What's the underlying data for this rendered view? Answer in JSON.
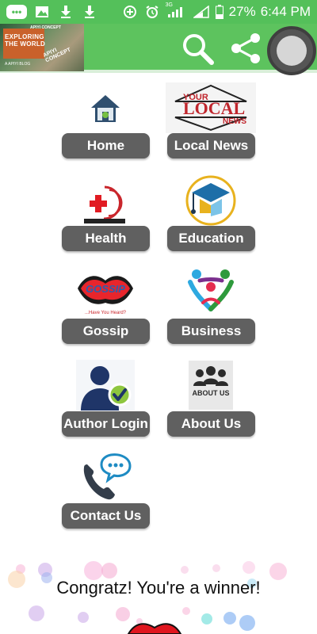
{
  "status_bar": {
    "battery_percent": "27%",
    "time": "6:44 PM",
    "network": "3G"
  },
  "app_bar": {
    "logo": {
      "title_line1": "EXPLORING",
      "title_line2": "THE WORLD",
      "tagline": "A APIYI BLOG",
      "brand": "APIYI CONCEPT",
      "brand_top": "APIYI CONCEPT"
    },
    "search_icon": "search-icon",
    "share_icon": "share-icon"
  },
  "tiles": [
    {
      "label": "Home",
      "icon": "home-icon"
    },
    {
      "label": "Local News",
      "icon": "local-news-logo",
      "icon_text_top": "YOUR",
      "icon_text_mid": "LOCAL",
      "icon_text_bot": "NEWS"
    },
    {
      "label": "Health",
      "icon": "health-cross-icon"
    },
    {
      "label": "Education",
      "icon": "graduation-cap-icon"
    },
    {
      "label": "Gossip",
      "icon": "gossip-lips-logo",
      "icon_text": "GOSSIP",
      "icon_sub": "...Have You Heard?"
    },
    {
      "label": "Business",
      "icon": "business-people-icon"
    },
    {
      "label": "Author Login",
      "icon": "author-check-icon"
    },
    {
      "label": "About Us",
      "icon": "about-us-icon",
      "icon_text": "ABOUT US"
    },
    {
      "label": "Contact Us",
      "icon": "contact-phone-icon"
    }
  ],
  "footer": {
    "message": "Congratz! You're a winner!"
  },
  "colors": {
    "app_bar_green": "#5dc35e",
    "status_bar_green": "#54c05a",
    "button_gray": "#606060"
  }
}
